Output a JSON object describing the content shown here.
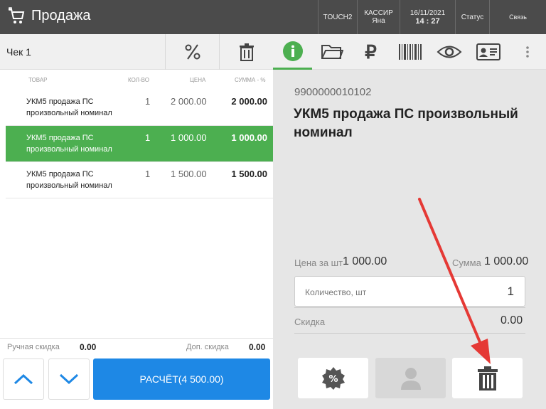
{
  "topbar": {
    "title": "Продажа",
    "terminal": "TOUCH2",
    "cashier_label": "КАССИР",
    "cashier_name": "Яна",
    "date": "16/11/2021",
    "time": "14 : 27",
    "status": "Статус",
    "link": "Связь"
  },
  "check": {
    "title": "Чек 1",
    "columns": {
      "item": "ТОВАР",
      "qty": "КОЛ-ВО",
      "price": "ЦЕНА",
      "sum": "СУММА - %"
    },
    "items": [
      {
        "name": "УКМ5 продажа ПС произвольный номинал",
        "qty": "1",
        "price": "2 000.00",
        "sum": "2 000.00",
        "selected": false
      },
      {
        "name": "УКМ5 продажа ПС произвольный номинал",
        "qty": "1",
        "price": "1 000.00",
        "sum": "1 000.00",
        "selected": true
      },
      {
        "name": "УКМ5 продажа ПС произвольный номинал",
        "qty": "1",
        "price": "1 500.00",
        "sum": "1 500.00",
        "selected": false
      }
    ],
    "manual_discount_label": "Ручная скидка",
    "manual_discount_value": "0.00",
    "extra_discount_label": "Доп. скидка",
    "extra_discount_value": "0.00",
    "pay_label": "РАСЧЁТ(4 500.00)"
  },
  "detail": {
    "barcode": "9900000010102",
    "name": "УКМ5 продажа ПС произвольный номинал",
    "unit_price_label": "Цена за шт",
    "unit_price": "1 000.00",
    "sum_label": "Сумма",
    "sum": "1 000.00",
    "qty_label": "Количество, шт",
    "qty": "1",
    "discount_label": "Скидка",
    "discount": "0.00"
  },
  "icons": {
    "cart": "cart-icon",
    "percent": "percent-icon",
    "trash": "trash-icon",
    "info": "info-icon",
    "folder": "folder-icon",
    "ruble": "ruble-icon",
    "barcode": "barcode-icon",
    "eye": "eye-icon",
    "card": "id-card-icon",
    "more": "more-vert-icon",
    "up": "chevron-up-icon",
    "down": "chevron-down-icon",
    "discount_badge": "discount-badge-icon",
    "person": "person-icon"
  },
  "colors": {
    "accent": "#4caf50",
    "primary": "#1e88e5",
    "topbar": "#4b4b4b",
    "annotation": "#e53935"
  }
}
